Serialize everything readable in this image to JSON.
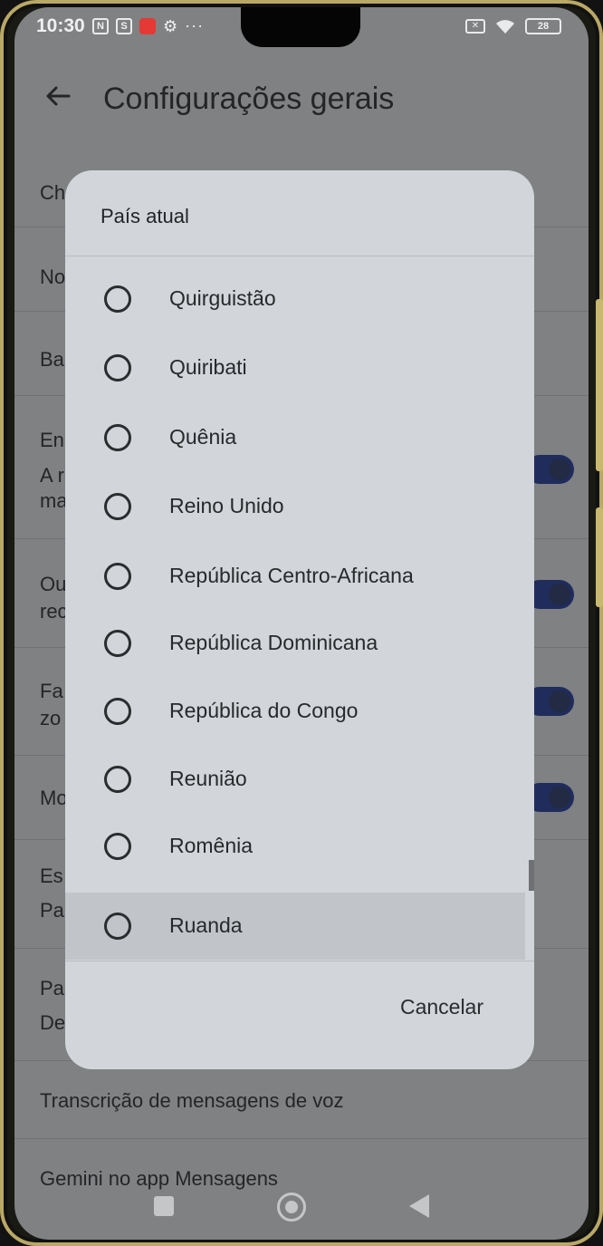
{
  "status_bar": {
    "time": "10:30",
    "nfc_glyph": "N",
    "sim_glyph": "S",
    "gear_glyph": "⚙",
    "more_glyph": "···",
    "battery": "28",
    "x_glyph": "✕"
  },
  "header": {
    "title": "Configurações gerais",
    "back_glyph": "←"
  },
  "background_list": {
    "items": [
      {
        "label": "Ch"
      },
      {
        "label": "No"
      },
      {
        "label": "Ba"
      },
      {
        "label": "En",
        "line2": "A r",
        "line3": "ma"
      },
      {
        "label": "Ou",
        "line2": "rec"
      },
      {
        "label": "Fa",
        "line2": "zo"
      },
      {
        "label": "Mo"
      },
      {
        "label": "Es",
        "line2": "Pa"
      },
      {
        "label": "Pa",
        "line2": "De"
      },
      {
        "label": "Transcrição de mensagens de voz"
      },
      {
        "label": "Gemini no app Mensagens"
      }
    ]
  },
  "dialog": {
    "title": "País atual",
    "options": [
      {
        "label": "Quirguistão",
        "selected": false
      },
      {
        "label": "Quiribati",
        "selected": false
      },
      {
        "label": "Quênia",
        "selected": false
      },
      {
        "label": "Reino Unido",
        "selected": false
      },
      {
        "label": "República Centro-Africana",
        "selected": false
      },
      {
        "label": "República Dominicana",
        "selected": false
      },
      {
        "label": "República do Congo",
        "selected": false
      },
      {
        "label": "Reunião",
        "selected": false
      },
      {
        "label": "Romênia",
        "selected": false
      },
      {
        "label": "Ruanda",
        "selected": false,
        "highlighted": true
      }
    ],
    "cancel_label": "Cancelar"
  },
  "colors": {
    "dialog_bg": "#d2d5d9",
    "scrim": "#7f8183",
    "toggle_on": "#1f2c5c"
  }
}
